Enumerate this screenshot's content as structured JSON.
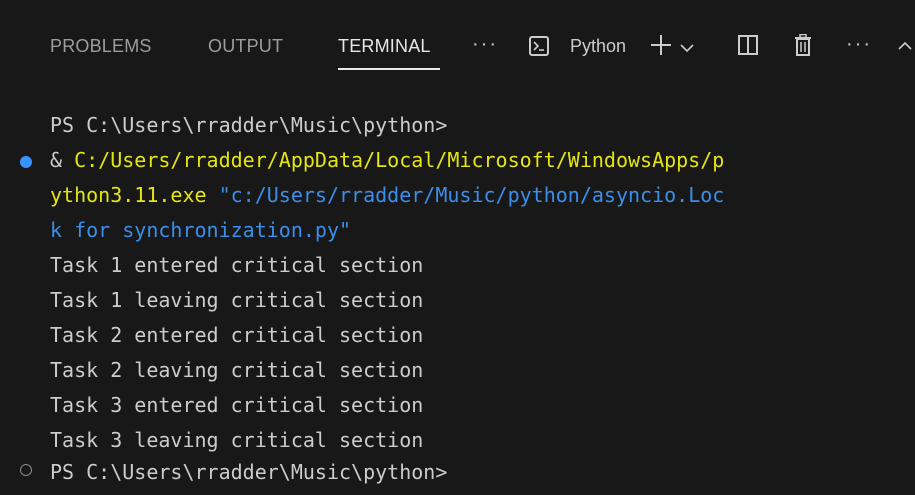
{
  "tabs": [
    {
      "label": "PROBLEMS",
      "active": false
    },
    {
      "label": "OUTPUT",
      "active": false
    },
    {
      "label": "TERMINAL",
      "active": true
    }
  ],
  "toolbar": {
    "more_label": "···",
    "terminal_profile": "Python",
    "icons": [
      "terminal-icon",
      "plus-icon",
      "chevron-down-icon",
      "split-icon",
      "trash-icon",
      "more-icon",
      "chevron-up-icon"
    ]
  },
  "terminal": {
    "prompt_first": "PS C:\\Users\\rradder\\Music\\python>",
    "command_amp": "& ",
    "command_exe_part1": "C:/Users/rradder/AppData/Local/Microsoft/WindowsApps/p",
    "command_exe_part2": "ython3.11.exe",
    "command_arg_part1": "\"c:/Users/rradder/Music/python/asyncio.Loc",
    "command_arg_part2": "k for synchronization.py\"",
    "output": [
      "Task 1 entered critical section",
      "Task 1 leaving critical section",
      "Task 2 entered critical section",
      "Task 2 leaving critical section",
      "Task 3 entered critical section",
      "Task 3 leaving critical section"
    ],
    "prompt_last": "PS C:\\Users\\rradder\\Music\\python>"
  },
  "colors": {
    "background": "#181818",
    "yellow": "#e5e510",
    "blue": "#3b8eea",
    "marker": "#3794ff"
  }
}
